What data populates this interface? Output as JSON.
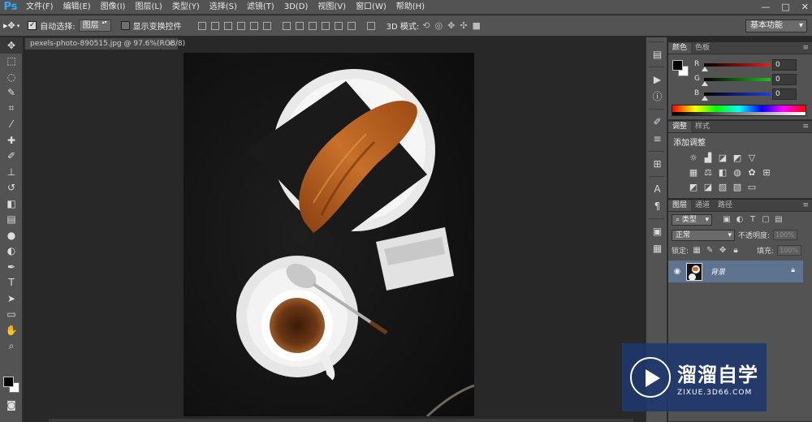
{
  "menubar": {
    "logo": "Ps",
    "items": [
      "文件(F)",
      "编辑(E)",
      "图像(I)",
      "图层(L)",
      "类型(Y)",
      "选择(S)",
      "滤镜(T)",
      "3D(D)",
      "视图(V)",
      "窗口(W)",
      "帮助(H)"
    ],
    "window_controls": [
      "—",
      "□",
      "✕"
    ]
  },
  "options": {
    "auto_select_label": "自动选择:",
    "auto_select_value": "图层",
    "show_transform_label": "显示变换控件",
    "mode_3d_label": "3D 模式:",
    "workspace": "基本功能"
  },
  "document": {
    "tab_title": "pexels-photo-890515.jpg @ 97.6%(RGB/8)",
    "close": "×"
  },
  "color_panel": {
    "tabs": [
      "颜色",
      "色板"
    ],
    "channels": [
      {
        "label": "R",
        "value": "0",
        "color": "#e02020"
      },
      {
        "label": "G",
        "value": "0",
        "color": "#20c020"
      },
      {
        "label": "B",
        "value": "0",
        "color": "#2040e0"
      }
    ]
  },
  "adjust_panel": {
    "tabs": [
      "调整",
      "样式"
    ],
    "title": "添加调整"
  },
  "layers_panel": {
    "tabs": [
      "图层",
      "通道",
      "路径"
    ],
    "filter_label": "类型",
    "blend_mode": "正常",
    "opacity_label": "不透明度:",
    "opacity_value": "100%",
    "lock_label": "锁定:",
    "fill_label": "填充:",
    "fill_value": "100%",
    "layer_name": "背景"
  },
  "watermark": {
    "cn": "溜溜自学",
    "en": "ZIXUE.3D66.COM"
  }
}
